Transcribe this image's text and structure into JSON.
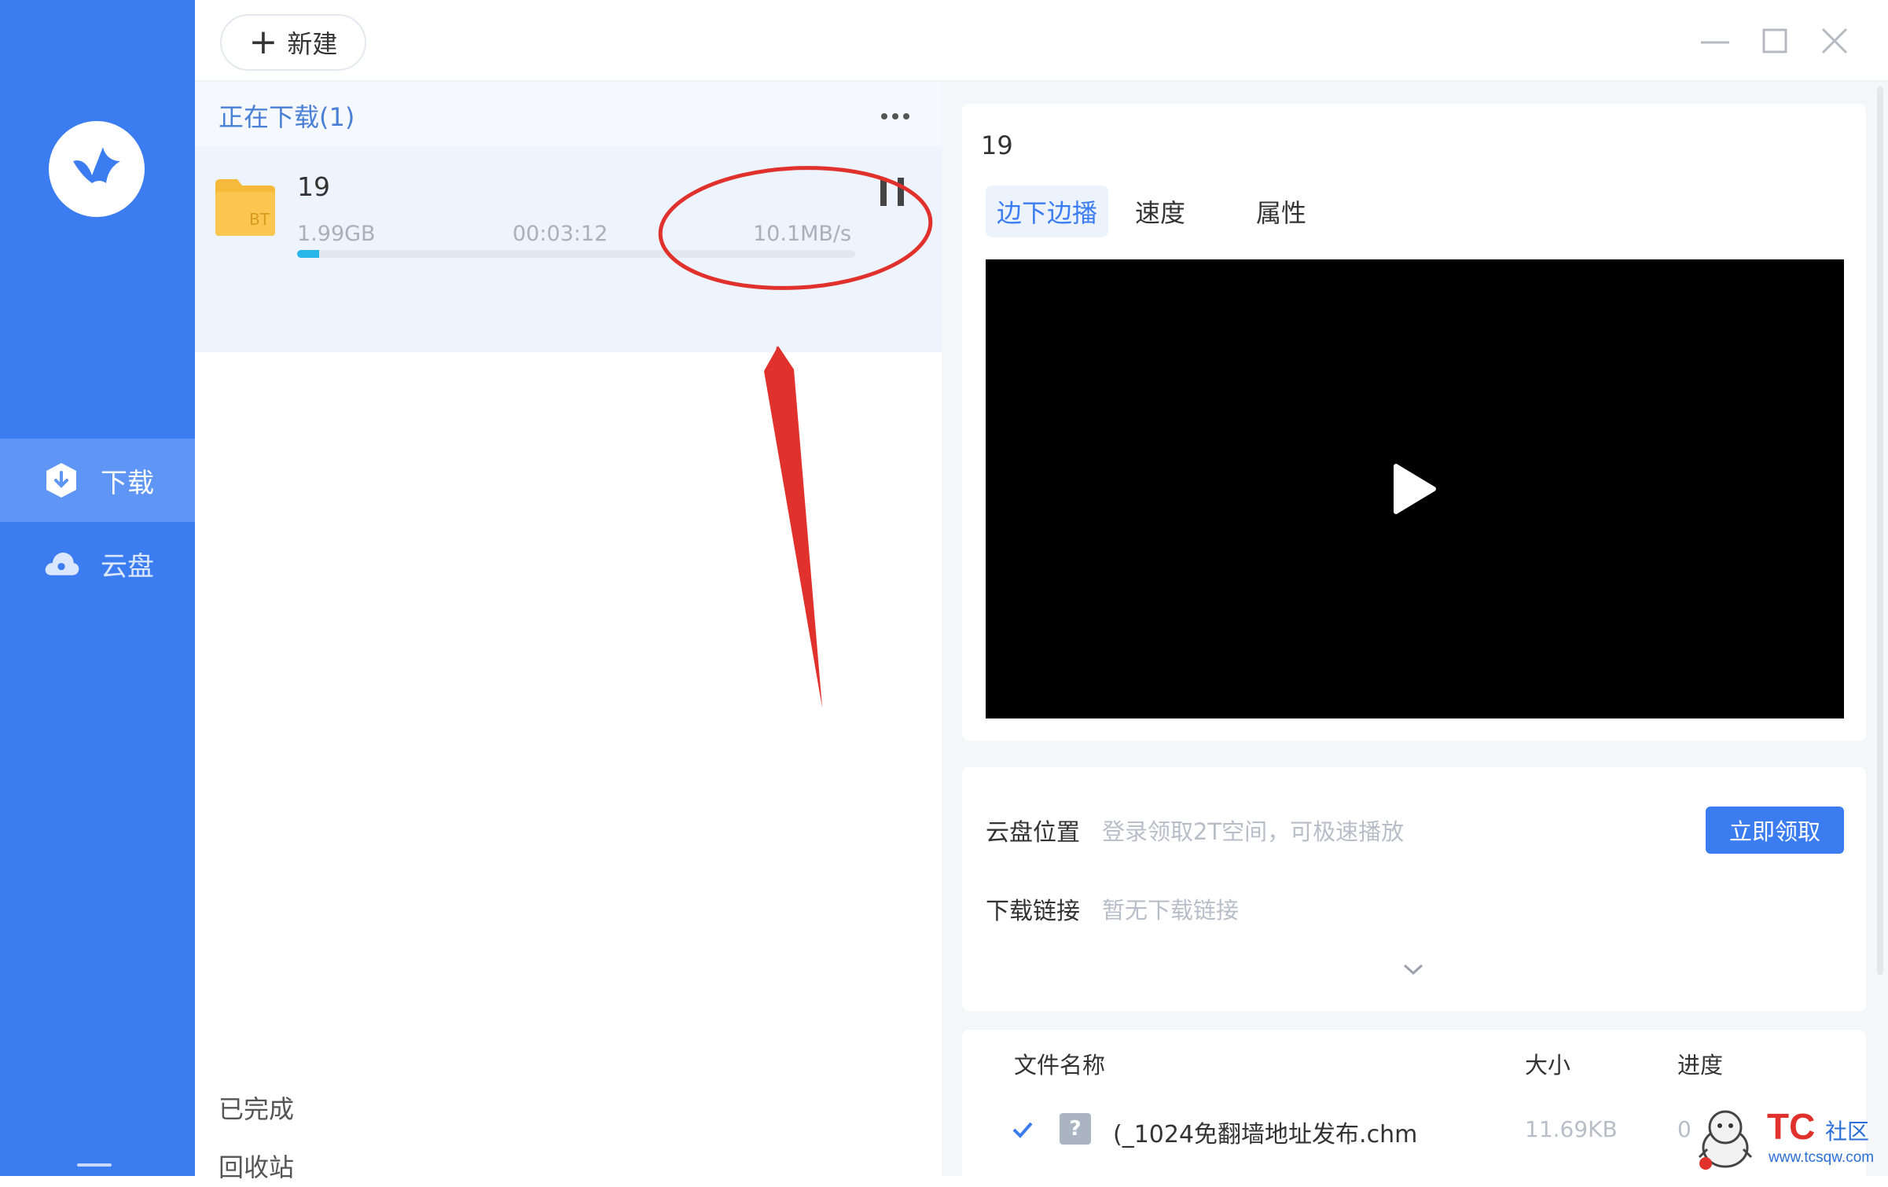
{
  "toolbar": {
    "new_label": "新建",
    "new_icon": "plus-icon"
  },
  "window_controls": [
    "minimize-icon",
    "maximize-icon",
    "close-icon"
  ],
  "sidebar": {
    "logo_icon": "bird-logo-icon",
    "items": [
      {
        "label": "下载",
        "icon": "download-shield-icon",
        "active": true
      },
      {
        "label": "云盘",
        "icon": "cloud-icon",
        "active": false
      }
    ]
  },
  "download_list": {
    "section_title": "正在下载(1)",
    "more_icon": "more-dots-icon",
    "task": {
      "name": "19",
      "type_badge": "BT",
      "size": "1.99GB",
      "time_remaining": "00:03:12",
      "speed": "10.1MB/s",
      "progress": 0.04
    },
    "footer": {
      "completed_label": "已完成",
      "recycle_label": "回收站"
    }
  },
  "detail": {
    "title": "19",
    "tabs": [
      {
        "label": "边下边播",
        "active": true
      },
      {
        "label": "速度",
        "active": false
      },
      {
        "label": "属性",
        "active": false
      }
    ],
    "player": {
      "play_icon": "play-icon"
    },
    "cloud_location_label": "云盘位置",
    "cloud_location_value": "登录领取2T空间，可极速播放",
    "claim_button": "立即领取",
    "download_link_label": "下载链接",
    "download_link_value": "暂无下载链接",
    "file_table": {
      "columns": [
        "文件名称",
        "大小",
        "进度"
      ],
      "rows": [
        {
          "name": "(_1024免翻墙地址发布.chm",
          "size": "11.69KB",
          "progress": "0",
          "checked": true,
          "icon": "unknown-file-icon"
        }
      ]
    }
  },
  "watermark": {
    "brand": "TC",
    "sub": "社区",
    "url": "www.tcsqw.com"
  },
  "colors": {
    "sidebar": "#3b7df1",
    "accent": "#3b7df1",
    "annotation_red": "#e0312c",
    "progress": "#29b6e8"
  }
}
